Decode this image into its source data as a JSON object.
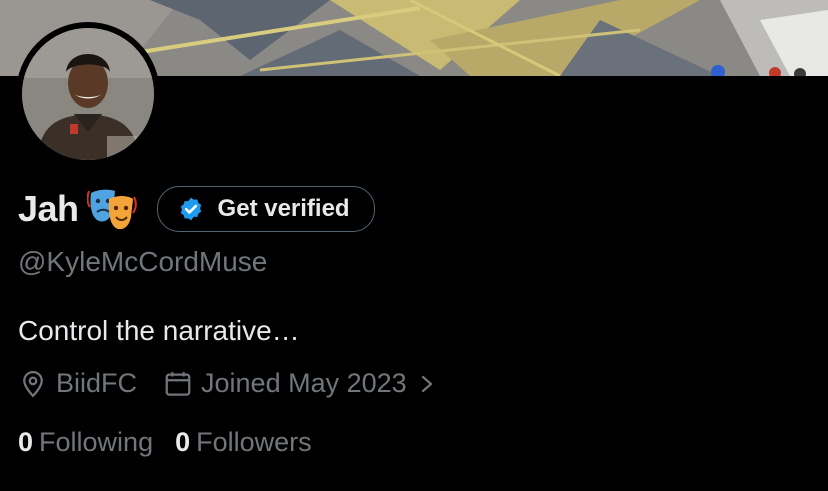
{
  "profile": {
    "display_name": "Jah",
    "name_emoji_icon": "performing-arts-masks-icon",
    "handle": "@KyleMcCordMuse",
    "bio": "Control the narrative…",
    "location": "BiidFC",
    "joined": "Joined May 2023",
    "following_count": "0",
    "following_label": "Following",
    "followers_count": "0",
    "followers_label": "Followers"
  },
  "verify_button": {
    "label": "Get verified",
    "icon": "verified-badge-icon"
  },
  "icons": {
    "location": "location-pin-icon",
    "calendar": "calendar-icon",
    "chevron": "chevron-right-icon"
  },
  "colors": {
    "background": "#000000",
    "primary_text": "#e7e9ea",
    "secondary_text": "#71767b",
    "verified_blue": "#1d9bf0",
    "button_border": "#536471"
  }
}
